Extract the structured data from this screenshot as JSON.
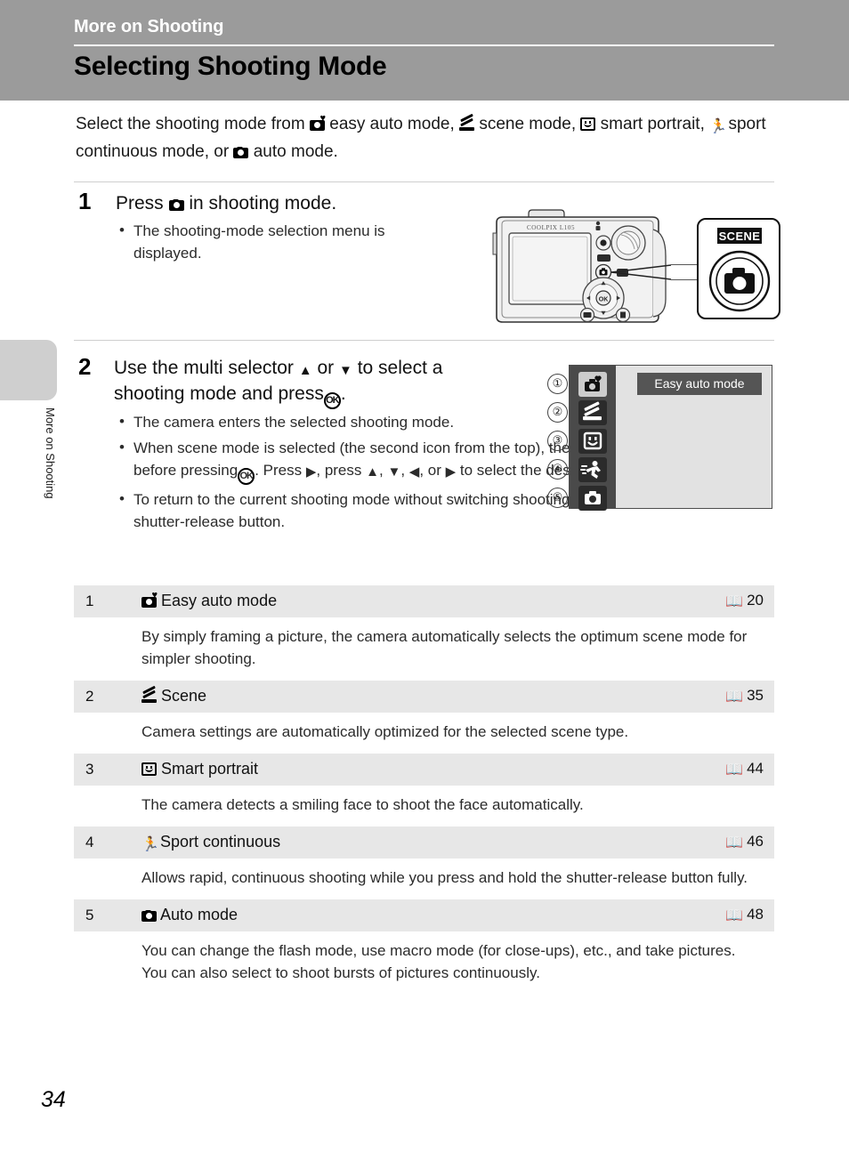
{
  "header": {
    "chapter": "More on Shooting",
    "title": "Selecting Shooting Mode"
  },
  "side_tab": {
    "label": "More on Shooting"
  },
  "intro": {
    "lead": "Select the shooting mode from",
    "part1": "easy auto mode,",
    "part2": "scene mode,",
    "part3": "smart portrait,",
    "part4": "sport continuous mode, or",
    "part5": "auto mode."
  },
  "steps": [
    {
      "number": "1",
      "head_before": "Press",
      "head_after": "in shooting mode.",
      "bullets": [
        "The shooting-mode selection menu is displayed."
      ]
    },
    {
      "number": "2",
      "head_before": "Use the multi selector",
      "head_mid_or": "or",
      "head_mid2": "to select a shooting mode and press",
      "head_end": ".",
      "bullets": [
        "The camera enters the selected shooting mode.",
        "When scene mode is selected (the second icon from the top), the scene type can be changed before pressing",
        "To return to the current shooting mode without switching shooting modes, press"
      ],
      "bullet2_mid": ". Press",
      "bullet2_mid2": ", press",
      "bullet2_mid3": ", or",
      "bullet2_end": "to select the desired scene type, then press",
      "bullet3_end": "or the shutter-release button."
    }
  ],
  "camera_illustration": {
    "model_label": "COOLPIX L105",
    "callout_label": "SCENE",
    "callout_icon": "camera-icon"
  },
  "lcd_menu": {
    "selected_label": "Easy auto mode",
    "items": [
      {
        "number": "①",
        "icon": "easy-auto-icon",
        "selected": true
      },
      {
        "number": "②",
        "icon": "scene-icon",
        "selected": false
      },
      {
        "number": "③",
        "icon": "smart-portrait-icon",
        "selected": false
      },
      {
        "number": "④",
        "icon": "sport-continuous-icon",
        "selected": false
      },
      {
        "number": "⑤",
        "icon": "auto-mode-icon",
        "selected": false
      }
    ]
  },
  "table": {
    "rows": [
      {
        "index": "1",
        "icon": "easy-auto-icon",
        "title": "Easy auto mode",
        "ref_page": "20",
        "description": "By simply framing a picture, the camera automatically selects the optimum scene mode for simpler shooting."
      },
      {
        "index": "2",
        "icon": "scene-icon",
        "title": "Scene",
        "ref_page": "35",
        "description": "Camera settings are automatically optimized for the selected scene type."
      },
      {
        "index": "3",
        "icon": "smart-portrait-icon",
        "title": "Smart portrait",
        "ref_page": "44",
        "description": "The camera detects a smiling face to shoot the face automatically."
      },
      {
        "index": "4",
        "icon": "sport-continuous-icon",
        "title": "Sport continuous",
        "ref_page": "46",
        "description": "Allows rapid, continuous shooting while you press and hold the shutter-release button fully."
      },
      {
        "index": "5",
        "icon": "auto-mode-icon",
        "title": "Auto mode",
        "ref_page": "48",
        "description": "You can change the flash mode, use macro mode (for close-ups), etc., and take pictures. You can also select to shoot bursts of pictures continuously."
      }
    ]
  },
  "page_number": "34",
  "colors": {
    "header_band": "#9b9b9b",
    "side_tab": "#cfcfcf",
    "table_row_head": "#e7e7e7",
    "lcd_strip": "#4a4a4a",
    "lcd_screen": "#e2e2e2",
    "lcd_label_bg": "#555555"
  }
}
